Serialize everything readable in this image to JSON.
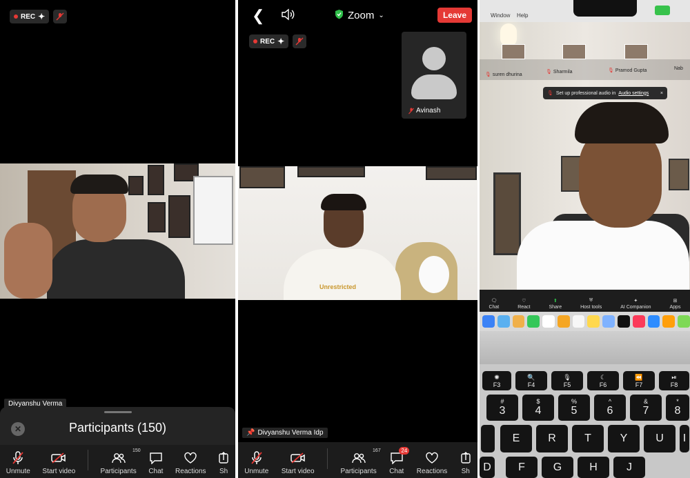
{
  "panel1": {
    "rec_label": "REC",
    "name_tag": "Divyanshu Verma",
    "participants_title": "Participants (150)",
    "toolbar": [
      {
        "label": "Unmute",
        "icon": "mic-muted-icon"
      },
      {
        "label": "Start video",
        "icon": "video-off-icon"
      },
      {
        "label": "Participants",
        "icon": "participants-icon",
        "count": "150"
      },
      {
        "label": "Chat",
        "icon": "chat-icon"
      },
      {
        "label": "Reactions",
        "icon": "heart-icon"
      },
      {
        "label": "Sh",
        "icon": "share-icon"
      }
    ]
  },
  "panel2": {
    "app_title": "Zoom",
    "leave_label": "Leave",
    "rec_label": "REC",
    "avatar_name": "Avinash",
    "name_tag": "Divyanshu Verma Idp",
    "shirt_text": "Unrestricted",
    "toolbar": [
      {
        "label": "Unmute",
        "icon": "mic-muted-icon"
      },
      {
        "label": "Start video",
        "icon": "video-off-icon"
      },
      {
        "label": "Participants",
        "icon": "participants-icon",
        "count": "167"
      },
      {
        "label": "Chat",
        "icon": "chat-icon",
        "badge": "24"
      },
      {
        "label": "Reactions",
        "icon": "heart-icon"
      },
      {
        "label": "Sh",
        "icon": "share-icon"
      }
    ]
  },
  "panel3": {
    "menu": [
      "Window",
      "Help"
    ],
    "gallery": [
      "suren dhurina",
      "Sharmila",
      "Pramod Gupta",
      "Nab"
    ],
    "toast_text": "Set up professional audio in",
    "toast_link": "Audio settings",
    "toast_close": "×",
    "toolbar": [
      "Chat",
      "React",
      "Share",
      "Host tools",
      "AI Companion",
      "Apps"
    ],
    "fn_keys": [
      {
        "icon": "✺",
        "label": "F3"
      },
      {
        "icon": "🔍",
        "label": "F4"
      },
      {
        "icon": "🎙",
        "label": "F5"
      },
      {
        "icon": "☾",
        "label": "F6"
      },
      {
        "icon": "⏪",
        "label": "F7"
      },
      {
        "icon": "⏯",
        "label": "F8"
      }
    ],
    "num_keys": [
      {
        "top": "#",
        "bottom": "3"
      },
      {
        "top": "$",
        "bottom": "4"
      },
      {
        "top": "%",
        "bottom": "5"
      },
      {
        "top": "^",
        "bottom": "6"
      },
      {
        "top": "&",
        "bottom": "7"
      },
      {
        "top": "*",
        "bottom": "8"
      }
    ],
    "row_keys": [
      "E",
      "R",
      "T",
      "Y",
      "U",
      "I"
    ],
    "home_keys": [
      "D",
      "F",
      "G",
      "H",
      "J"
    ]
  },
  "colors": {
    "leave": "#e53935",
    "rec_dot": "#e53935",
    "shield": "#2fbf4a",
    "chat_badge": "#e53935"
  }
}
